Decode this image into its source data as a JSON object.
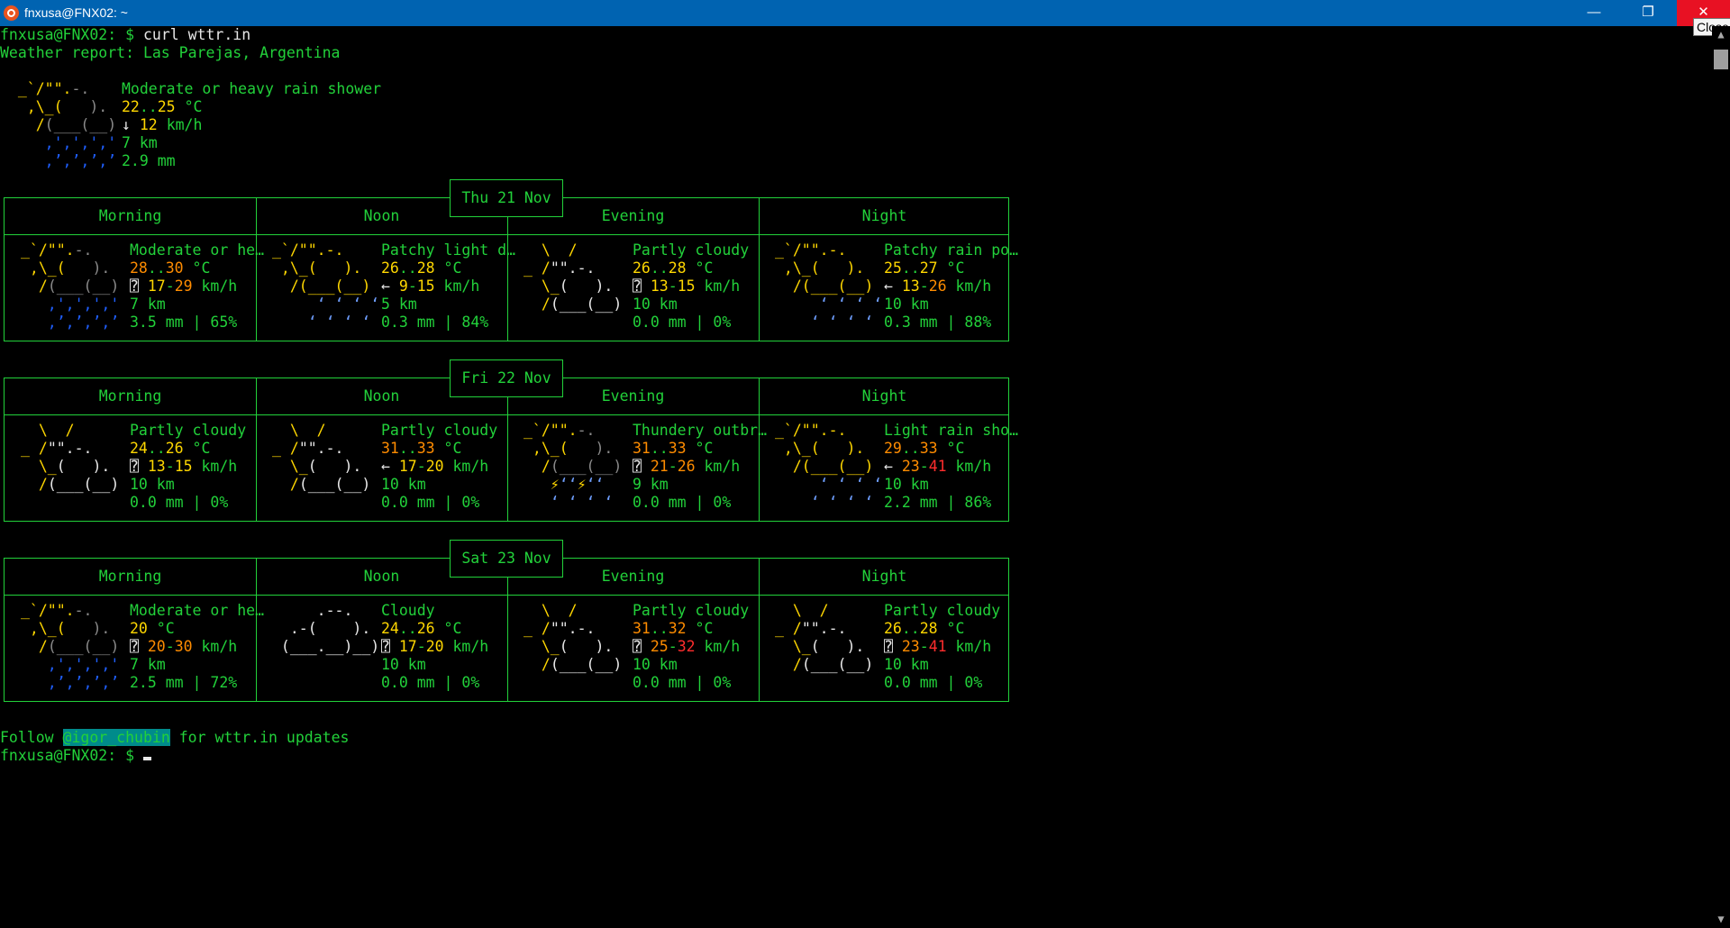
{
  "window": {
    "title": "fnxusa@FNX02: ~",
    "minimize_glyph": "—",
    "maximize_glyph": "❐",
    "close_glyph": "✕",
    "close_tooltip": "Close"
  },
  "prompt": "fnxusa@FNX02: $",
  "command": "curl wttr.in",
  "report_line": "Weather report: Las Parejas, Argentina",
  "current": {
    "condition": "Moderate or heavy rain shower",
    "temp_a": "22",
    "temp_b": "25",
    "temp_unit": "°C",
    "wind_arrow": "↓",
    "wind": "12",
    "wind_unit": "km/h",
    "visibility": "7 km",
    "precip": "2.9 mm"
  },
  "periods": [
    "Morning",
    "Noon",
    "Evening",
    "Night"
  ],
  "days": [
    {
      "label": "Thu 21 Nov",
      "cells": [
        {
          "condition": "Moderate or he…",
          "t1": "28",
          "t2": "30",
          "arrow": "⍰",
          "w1": "17",
          "w2": "29",
          "vis": "7 km",
          "precip": "3.5 mm | 65%"
        },
        {
          "condition": "Patchy light d…",
          "t1": "26",
          "t2": "28",
          "arrow": "←",
          "w1": "9",
          "w2": "15",
          "vis": "5 km",
          "precip": "0.3 mm | 84%"
        },
        {
          "condition": "Partly cloudy",
          "t1": "26",
          "t2": "28",
          "arrow": "⍰",
          "w1": "13",
          "w2": "15",
          "vis": "10 km",
          "precip": "0.0 mm | 0%"
        },
        {
          "condition": "Patchy rain po…",
          "t1": "25",
          "t2": "27",
          "arrow": "←",
          "w1": "13",
          "w2": "26",
          "vis": "10 km",
          "precip": "0.3 mm | 88%"
        }
      ]
    },
    {
      "label": "Fri 22 Nov",
      "cells": [
        {
          "condition": "Partly cloudy",
          "t1": "24",
          "t2": "26",
          "arrow": "⍰",
          "w1": "13",
          "w2": "15",
          "vis": "10 km",
          "precip": "0.0 mm | 0%"
        },
        {
          "condition": "Partly cloudy",
          "t1": "31",
          "t2": "33",
          "arrow": "←",
          "w1": "17",
          "w2": "20",
          "vis": "10 km",
          "precip": "0.0 mm | 0%"
        },
        {
          "condition": "Thundery outbr…",
          "t1": "31",
          "t2": "33",
          "arrow": "⍰",
          "w1": "21",
          "w2": "26",
          "vis": "9 km",
          "precip": "0.0 mm | 0%"
        },
        {
          "condition": "Light rain sho…",
          "t1": "29",
          "t2": "33",
          "arrow": "←",
          "w1": "23",
          "w2": "41",
          "vis": "10 km",
          "precip": "2.2 mm | 86%"
        }
      ]
    },
    {
      "label": "Sat 23 Nov",
      "cells": [
        {
          "condition": "Moderate or he…",
          "t1": "20",
          "t2": "",
          "arrow": "⍰",
          "w1": "20",
          "w2": "30",
          "vis": "7 km",
          "precip": "2.5 mm | 72%"
        },
        {
          "condition": "Cloudy",
          "t1": "24",
          "t2": "26",
          "arrow": "⍰",
          "w1": "17",
          "w2": "20",
          "vis": "10 km",
          "precip": "0.0 mm | 0%"
        },
        {
          "condition": "Partly cloudy",
          "t1": "31",
          "t2": "32",
          "arrow": "⍰",
          "w1": "25",
          "w2": "32",
          "vis": "10 km",
          "precip": "0.0 mm | 0%"
        },
        {
          "condition": "Partly cloudy",
          "t1": "26",
          "t2": "28",
          "arrow": "⍰",
          "w1": "23",
          "w2": "41",
          "vis": "10 km",
          "precip": "0.0 mm | 0%"
        }
      ]
    }
  ],
  "footer": {
    "follow": "Follow",
    "handle": "@igor_chubin",
    "rest": "for wttr.in updates"
  },
  "scrollbar": {
    "up_glyph": "▲",
    "down_glyph": "▼"
  }
}
